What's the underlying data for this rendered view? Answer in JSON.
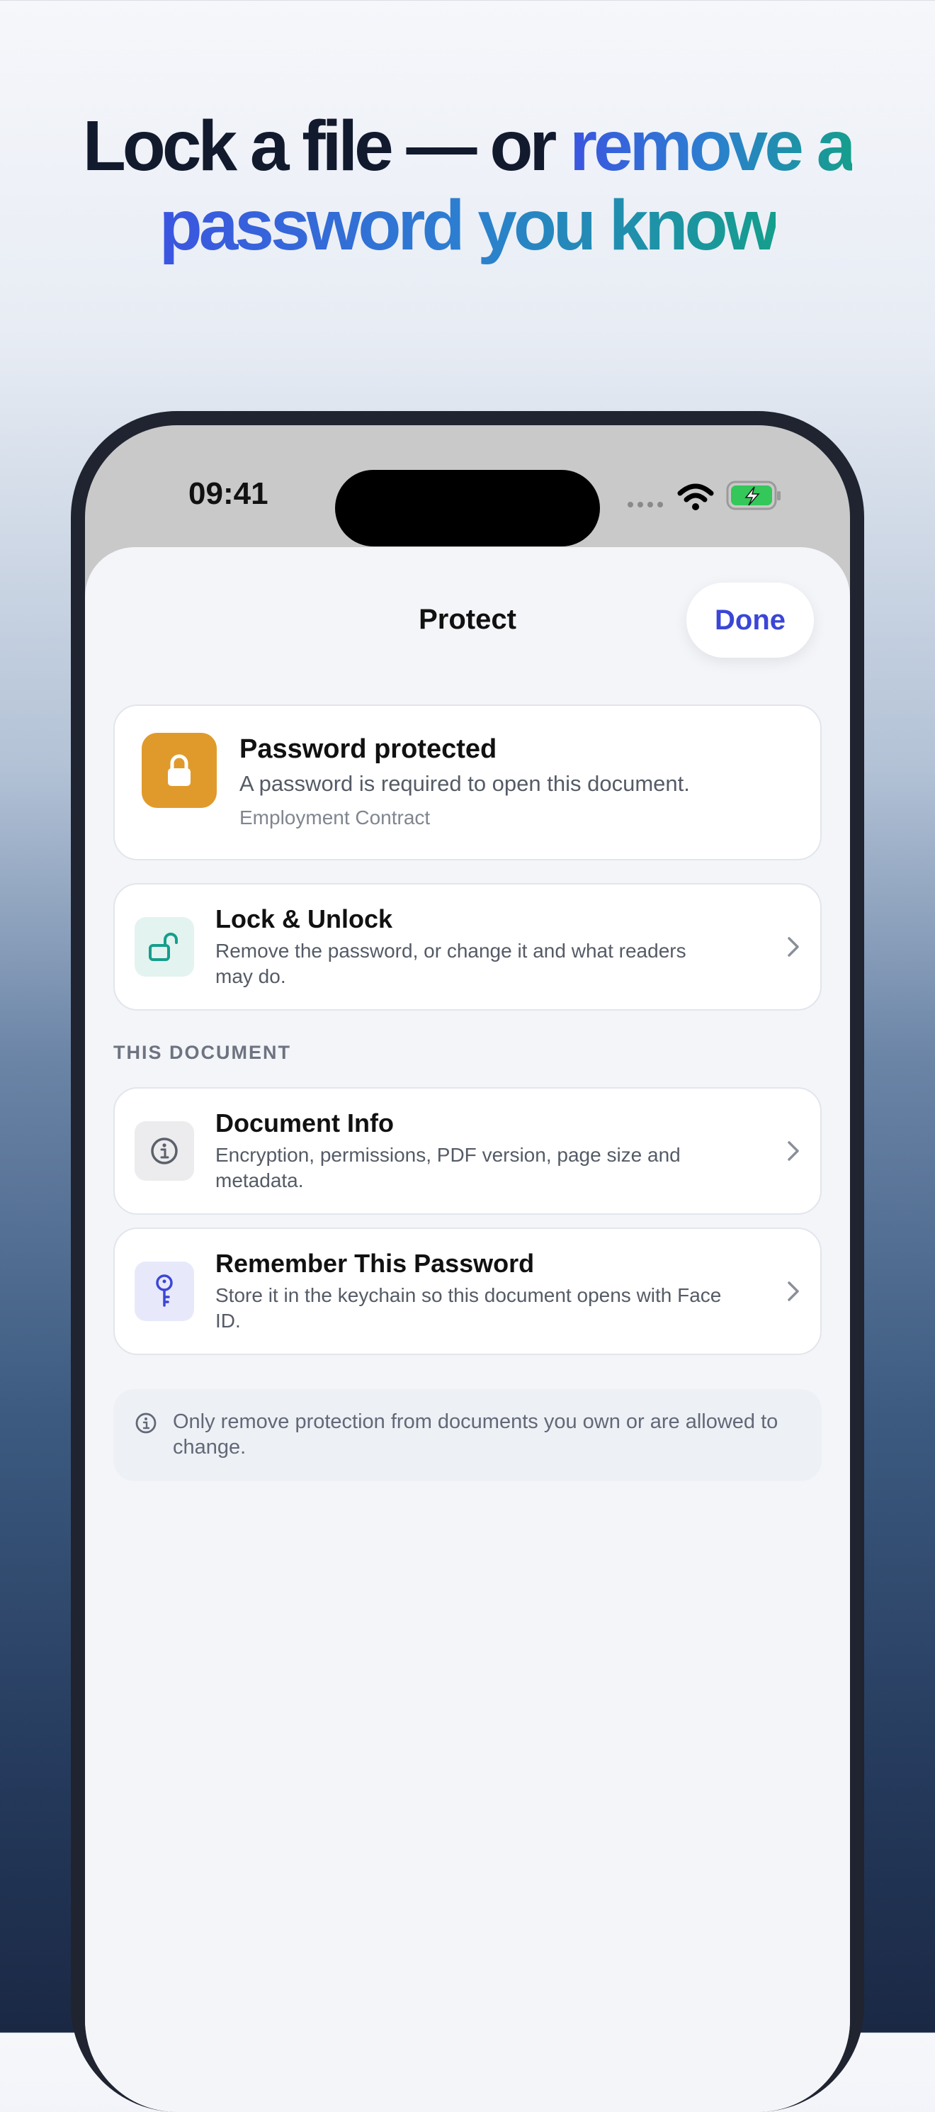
{
  "headline": {
    "line1_plain": "Lock a file — or",
    "line1_accent": "remove a",
    "line2_accent": "password you know"
  },
  "status_bar": {
    "time": "09:41"
  },
  "sheet": {
    "title": "Protect",
    "done_label": "Done"
  },
  "status_card": {
    "title": "Password protected",
    "subtitle": "A password is required to open this document.",
    "document_name": "Employment Contract",
    "icon": "lock-icon",
    "icon_color": "#e09a2c"
  },
  "lock_unlock": {
    "title": "Lock & Unlock",
    "subtitle": "Remove the password, or change it and what readers may do.",
    "icon": "unlock-icon",
    "icon_color": "#159e8c"
  },
  "section_label": "THIS DOCUMENT",
  "document_info": {
    "title": "Document Info",
    "subtitle": "Encryption, permissions, PDF version, page size and metadata.",
    "icon": "info-icon"
  },
  "remember_password": {
    "title": "Remember This Password",
    "subtitle": "Store it in the keychain so this document opens with Face ID.",
    "icon": "key-icon",
    "icon_color": "#3b46d6"
  },
  "note": {
    "text": "Only remove protection from documents you own or are allowed to change."
  },
  "colors": {
    "accent": "#3b46d6",
    "gradient_start": "#3b55e0",
    "gradient_end": "#159e8c"
  }
}
